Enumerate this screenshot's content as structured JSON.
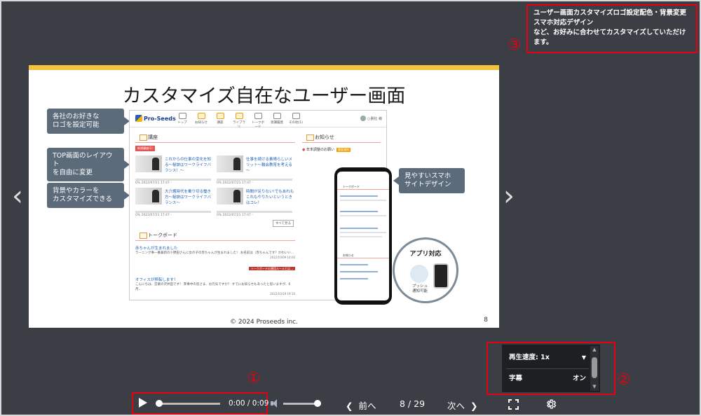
{
  "slide": {
    "title": "カスタマイズ自在なユーザー画面",
    "copyright": "© 2024 Proseeds inc.",
    "page_number": "8",
    "callouts": {
      "logo": "各社のお好きな\nロゴを設定可能",
      "layout": "TOP画面のレイアウト\nを自由に変更",
      "color": "背景やカラーを\nカスタマイズできる",
      "smartphone": "見やすいスマホ\nサイトデザイン"
    },
    "screen": {
      "logo": "Pro-Seeds",
      "nav": [
        "トップ",
        "お知らせ",
        "講座",
        "ライブラリ",
        "トークボード",
        "受講履歴",
        "その他(1)"
      ],
      "user": "○貴社 様",
      "courses_header": "講座",
      "courses_badge": "新規講座(1)",
      "courses": [
        {
          "title": "これからの仕事の変化を知る～秘訣はワークライフバランス！～",
          "progress": "0%",
          "date": "2022/07/21 17:47 -"
        },
        {
          "title": "仕事を続ける素晴らしいメリット～輪会教育を考える～",
          "progress": "0%",
          "date": "2022/07/21 17:47 -"
        },
        {
          "title": "大介護時代を乗り切る働き方～秘訣はワークライフバランス～",
          "progress": "0%",
          "date": "2022/07/21 17:47 -"
        },
        {
          "title": "時間が足りない!でもあれもこれもやりたいというときはコレ！",
          "progress": "0%",
          "date": "2022/07/21 17:47 -"
        }
      ],
      "see_all": "すべて見る",
      "talk_header": "トークボード",
      "talks": [
        {
          "title": "赤ちゃんが生まれました",
          "text": "ラーニング事一番兼新の小野田さんに女の子の赤ちゃんが生まれました！ お名前は（赤ちゃんです？かわいい…",
          "date": "2022/10/09 14:00",
          "tag": "トークボードの運用ルールとは…"
        },
        {
          "title": "オフィスが移転します！",
          "text": "こんにちは、営業の沢井田です！ 弊事中の皆さま、お元気ですか？ すでにお知らせもあったと思いますが、6月…",
          "date": "2022/10/19 19:10"
        }
      ],
      "notice_header": "お知らせ",
      "notice": "年末調整のお願い",
      "notice_tag": "重要通知"
    },
    "phone": {
      "sections": [
        "トークボード",
        "お知らせ"
      ]
    },
    "app": {
      "title": "アプリ対応",
      "push": "プッシュ\n通知可能"
    }
  },
  "note": {
    "line1": "ユーザー画面カスタマイズロゴ設定配色・背景変更",
    "line2": "スマホ対応デザイン",
    "line3": "など、お好みに合わせてカスタマイズしていただけます。"
  },
  "markers": {
    "one": "①",
    "two": "②",
    "three": "③"
  },
  "settings": {
    "speed_label": "再生速度: 1x",
    "caption_label": "字幕",
    "caption_value": "オン"
  },
  "controls": {
    "time": "0:00 / 0:09",
    "prev": "前へ",
    "next": "次へ",
    "page": "8 / 29",
    "playback_progress": 0,
    "volume": 0.9
  },
  "colors": {
    "accent": "#e60012",
    "background": "#3b3e45",
    "slide_bar": "#f3c33e"
  }
}
